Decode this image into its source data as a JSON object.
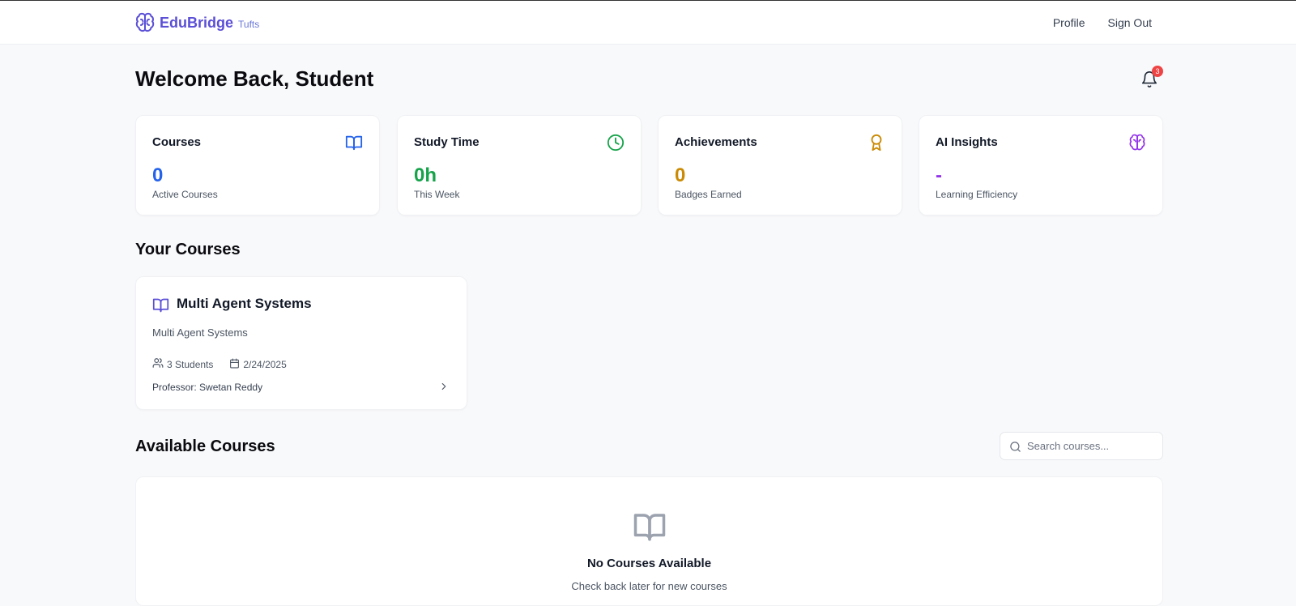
{
  "brand": {
    "name": "EduBridge",
    "sub": "Tufts"
  },
  "nav": {
    "profile": "Profile",
    "sign_out": "Sign Out"
  },
  "welcome": "Welcome Back, Student",
  "notifications": {
    "count": "3"
  },
  "stats": [
    {
      "title": "Courses",
      "value": "0",
      "sub": "Active Courses",
      "icon": "book-open-icon",
      "color": "#2563eb"
    },
    {
      "title": "Study Time",
      "value": "0h",
      "sub": "This Week",
      "icon": "clock-icon",
      "color": "#16a34a"
    },
    {
      "title": "Achievements",
      "value": "0",
      "sub": "Badges Earned",
      "icon": "award-icon",
      "color": "#ca8a04"
    },
    {
      "title": "AI Insights",
      "value": "-",
      "sub": "Learning Efficiency",
      "icon": "brain-icon",
      "color": "#9333ea"
    }
  ],
  "your_courses": {
    "title": "Your Courses",
    "items": [
      {
        "title": "Multi Agent Systems",
        "description": "Multi Agent Systems",
        "students": "3 Students",
        "date": "2/24/2025",
        "professor": "Professor: Swetan Reddy"
      }
    ]
  },
  "available_courses": {
    "title": "Available Courses",
    "search_placeholder": "Search courses...",
    "search_value": "",
    "empty_title": "No Courses Available",
    "empty_sub": "Check back later for new courses"
  },
  "colors": {
    "brand": "#5b4fd6",
    "background": "#f8f9fb",
    "badge": "#ef4444"
  }
}
